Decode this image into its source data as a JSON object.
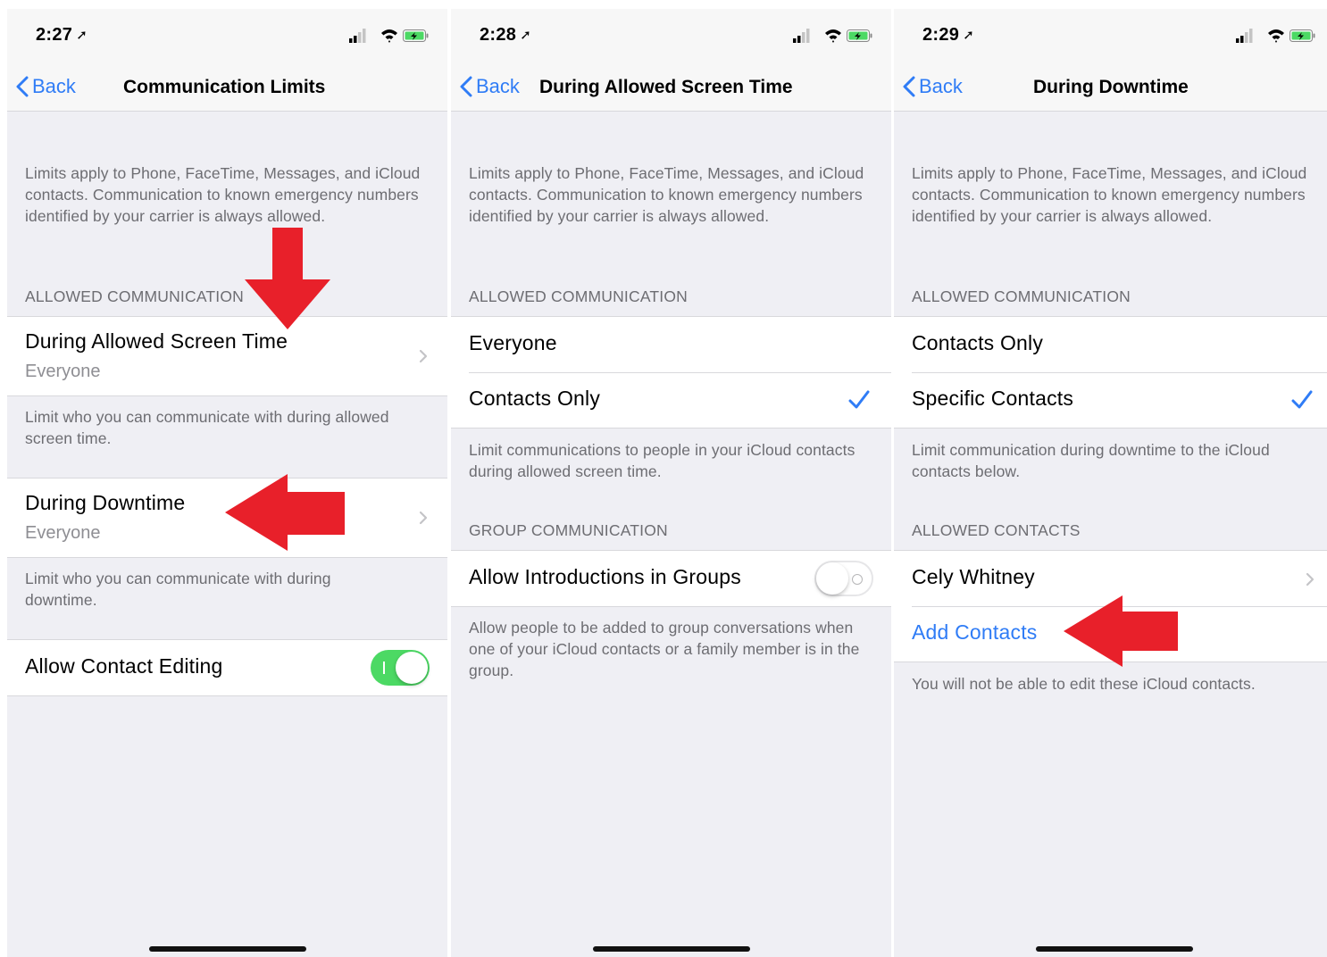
{
  "colors": {
    "ios_blue": "#2f7cf6",
    "toggle_green": "#4cd964",
    "annotation_red": "#e8202a"
  },
  "icons": [
    "location-arrow-icon",
    "signal-icon",
    "wifi-icon",
    "battery-charging-icon",
    "chevron-left-icon",
    "chevron-right-icon",
    "checkmark-icon"
  ],
  "screens": [
    {
      "status": {
        "time": "2:27"
      },
      "nav": {
        "back": "Back",
        "title": "Communication Limits"
      },
      "intro": "Limits apply to Phone, FaceTime, Messages, and iCloud contacts. Communication to known emergency numbers identified by your carrier is always allowed.",
      "header": "ALLOWED COMMUNICATION",
      "rows": [
        {
          "title": "During Allowed Screen Time",
          "value": "Everyone",
          "footer": "Limit who you can communicate with during allowed screen time."
        },
        {
          "title": "During Downtime",
          "value": "Everyone",
          "footer": "Limit who you can communicate with during downtime."
        }
      ],
      "toggle_row": {
        "label": "Allow Contact Editing",
        "on": true
      }
    },
    {
      "status": {
        "time": "2:28"
      },
      "nav": {
        "back": "Back",
        "title": "During Allowed Screen Time"
      },
      "intro": "Limits apply to Phone, FaceTime, Messages, and iCloud contacts. Communication to known emergency numbers identified by your carrier is always allowed.",
      "header": "ALLOWED COMMUNICATION",
      "options": [
        {
          "label": "Everyone",
          "selected": false
        },
        {
          "label": "Contacts Only",
          "selected": true
        }
      ],
      "options_footer": "Limit communications to people in your iCloud contacts during allowed screen time.",
      "group_header": "GROUP COMMUNICATION",
      "toggle_row": {
        "label": "Allow Introductions in Groups",
        "on": false
      },
      "toggle_footer": "Allow people to be added to group conversations when one of your iCloud contacts or a family member is in the group."
    },
    {
      "status": {
        "time": "2:29"
      },
      "nav": {
        "back": "Back",
        "title": "During Downtime"
      },
      "intro": "Limits apply to Phone, FaceTime, Messages, and iCloud contacts. Communication to known emergency numbers identified by your carrier is always allowed.",
      "header": "ALLOWED COMMUNICATION",
      "options": [
        {
          "label": "Contacts Only",
          "selected": false
        },
        {
          "label": "Specific Contacts",
          "selected": true
        }
      ],
      "options_footer": "Limit communication during downtime to the iCloud contacts below.",
      "contacts_header": "ALLOWED CONTACTS",
      "contacts": [
        {
          "name": "Cely Whitney"
        }
      ],
      "add_contacts": "Add Contacts",
      "contacts_footer": "You will not be able to edit these iCloud contacts."
    }
  ]
}
